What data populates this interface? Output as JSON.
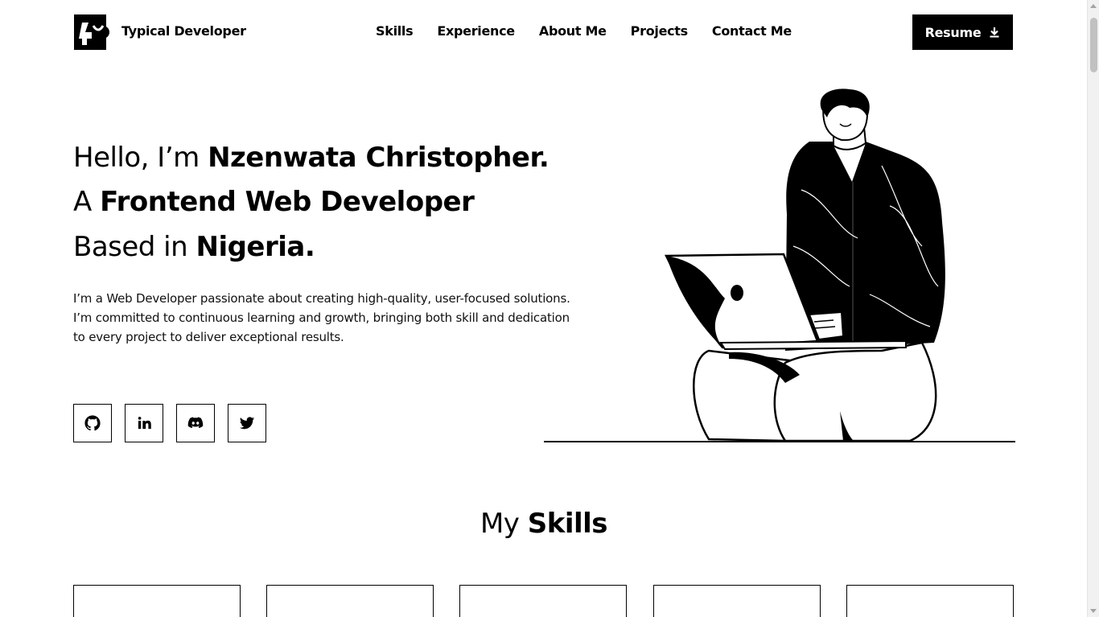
{
  "header": {
    "brand": "Typical Developer",
    "nav": [
      "Skills",
      "Experience",
      "About Me",
      "Projects",
      "Contact Me"
    ],
    "resume_label": "Resume"
  },
  "hero": {
    "line1_prefix": "Hello, I’m ",
    "line1_bold": "Nzenwata Christopher.",
    "line2_prefix": "A ",
    "line2_bold": "Frontend Web Developer",
    "line3_prefix": "Based in ",
    "line3_bold": "Nigeria.",
    "intro": "I’m a Web Developer passionate about creating high-quality, user-focused solutions. I’m committed to continuous learning and growth, bringing both skill and dedication to every project to deliver exceptional results."
  },
  "socials": [
    {
      "icon": "github-icon"
    },
    {
      "icon": "linkedin-icon"
    },
    {
      "icon": "discord-icon"
    },
    {
      "icon": "twitter-icon"
    }
  ],
  "skills": {
    "title_prefix": "My ",
    "title_bold": "Skills"
  },
  "colors": {
    "primary": "#000000",
    "background": "#ffffff"
  }
}
